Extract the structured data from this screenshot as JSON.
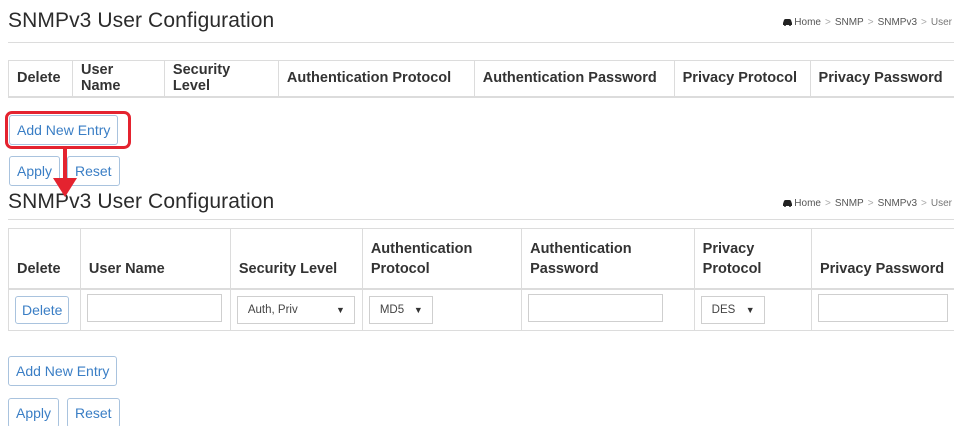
{
  "page_title": "SNMPv3 User Configuration",
  "breadcrumb": {
    "items": [
      "Home",
      "SNMP",
      "SNMPv3",
      "User"
    ],
    "separator": ">"
  },
  "top_table": {
    "headers": [
      "Delete",
      "User Name",
      "Security Level",
      "Authentication Protocol",
      "Authentication Password",
      "Privacy Protocol",
      "Privacy Password"
    ]
  },
  "bottom_table": {
    "headers": [
      "Delete",
      "User Name",
      "Security Level",
      "Authentication\nProtocol",
      "Authentication\nPassword",
      "Privacy\nProtocol",
      "Privacy Password"
    ],
    "row": {
      "delete_label": "Delete",
      "user_name": "",
      "security_level": "Auth, Priv",
      "auth_protocol": "MD5",
      "auth_password": "",
      "privacy_protocol": "DES",
      "privacy_password": ""
    }
  },
  "buttons": {
    "add_new_entry": "Add New Entry",
    "apply": "Apply",
    "reset": "Reset"
  },
  "colors": {
    "accent": "#3a7ec5",
    "annotation": "#e4232f",
    "border": "#dcdcdc"
  },
  "icons": {
    "home": "home-icon (car glyph)",
    "caret": "chevron-down-icon"
  }
}
